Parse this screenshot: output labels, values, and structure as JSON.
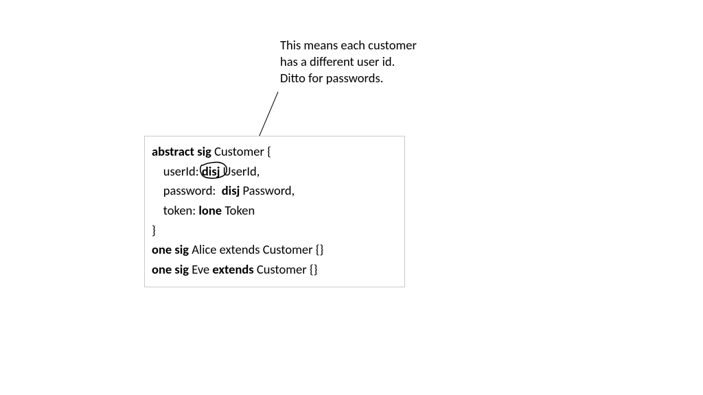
{
  "annotation": {
    "line1": "This means each customer",
    "line2": "has a different user id.",
    "line3": "Ditto for passwords."
  },
  "code": {
    "kw_abstract_sig": "abstract sig ",
    "customer_decl": "Customer {",
    "indent": "    ",
    "field_userId_label": "userId: ",
    "kw_disj": "disj",
    "field_userId_type": " UserId,",
    "field_password_label": "password:  ",
    "kw_disj2": "disj ",
    "field_password_type": "Password,",
    "field_token_label": "token: ",
    "kw_lone": "lone ",
    "field_token_type": "Token",
    "close_brace": "}",
    "kw_one_sig1": "one sig ",
    "alice": "Alice extends Customer {}",
    "kw_one_sig2": "one sig ",
    "eve_pre": "Eve ",
    "kw_extends": "extends ",
    "eve_post": "Customer {}"
  }
}
